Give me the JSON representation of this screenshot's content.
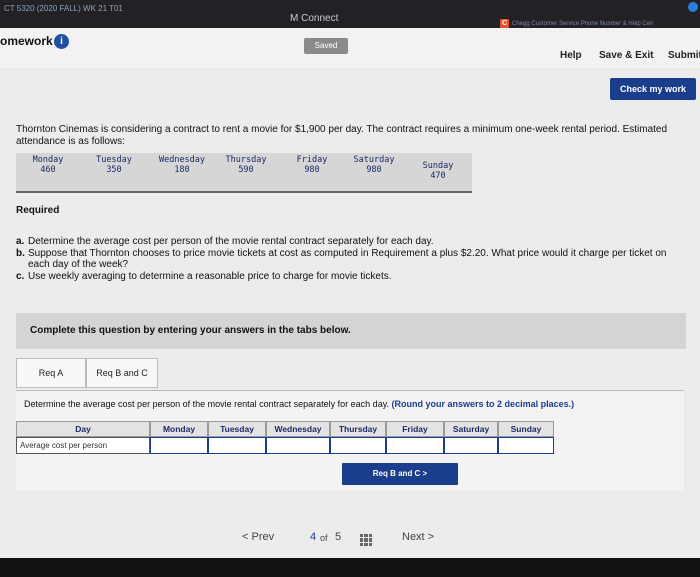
{
  "topbar": {
    "course": "CT 5320 (2020 FALL) WK 21 T01",
    "app": "M Connect",
    "chegg_mark": "C",
    "chegg_text": "Chegg Customer Service Phone Number & Help Cen"
  },
  "header": {
    "title": "omework",
    "info_icon": "i",
    "saved": "Saved",
    "help": "Help",
    "save_exit": "Save & Exit",
    "submit": "Submit"
  },
  "check_work": "Check my work",
  "problem_text": "Thornton Cinemas is considering a contract to rent a movie for $1,900 per day. The contract requires a minimum one-week rental period. Estimated attendance is as follows:",
  "attendance": [
    {
      "day": "Monday",
      "value": "460"
    },
    {
      "day": "Tuesday",
      "value": "350"
    },
    {
      "day": "Wednesday",
      "value": "180"
    },
    {
      "day": "Thursday",
      "value": "590"
    },
    {
      "day": "Friday",
      "value": "980"
    },
    {
      "day": "Saturday",
      "value": "980"
    },
    {
      "day": "Sunday",
      "value": "470"
    }
  ],
  "required": {
    "title": "Required",
    "items": [
      {
        "letter": "a.",
        "text": "Determine the average cost per person of the movie rental contract separately for each day."
      },
      {
        "letter": "b.",
        "text": "Suppose that Thornton chooses to price movie tickets at cost as computed in Requirement a plus $2.20. What price would it charge per ticket on each day of the week?"
      },
      {
        "letter": "c.",
        "text": "Use weekly averaging to determine a reasonable price to charge for movie tickets."
      }
    ]
  },
  "instruction": "Complete this question by entering your answers in the tabs below.",
  "tabs": [
    "Req A",
    "Req B and C"
  ],
  "answer": {
    "prompt": "Determine the average cost per person of the movie rental contract separately for each day.",
    "hint": "(Round your answers to 2 decimal places.)",
    "headers": [
      "Day",
      "Monday",
      "Tuesday",
      "Wednesday",
      "Thursday",
      "Friday",
      "Saturday",
      "Sunday"
    ],
    "row_label": "Average cost per person"
  },
  "next_tab_button": "Req B and C  >",
  "pager": {
    "prev": "< Prev",
    "current": "4",
    "of": "of",
    "total": "5",
    "next": "Next >"
  }
}
